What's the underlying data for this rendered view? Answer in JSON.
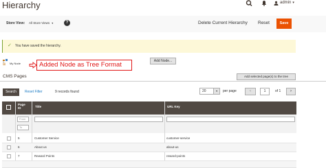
{
  "header": {
    "title": "Hierarchy",
    "user": "admin",
    "icons": [
      "search-icon",
      "bell-icon",
      "user-icon"
    ]
  },
  "toolbar": {
    "store_view_label": "Store View:",
    "store_view_value": "All Store Views",
    "delete_label": "Delete Current Hierarchy",
    "reset_label": "Reset",
    "save_label": "Save"
  },
  "message": {
    "text": "You have saved the hierarchy."
  },
  "tree": {
    "node_label": "My Node"
  },
  "annotation": {
    "text": "Added Node as Tree Format"
  },
  "buttons": {
    "add_node": "Add Node..."
  },
  "cms": {
    "title": "CMS Pages",
    "add_selected": "Add selected page(s) to the tree",
    "search": "Search",
    "reset_filter": "Reset Filter",
    "records_found": "9 records found",
    "per_page_value": "20",
    "per_page_label": "per page",
    "page_prev": "‹",
    "page_current": "1",
    "page_of": "of 1",
    "page_next": "›"
  },
  "grid": {
    "columns": {
      "id": "Page ID",
      "title": "Title",
      "url_key": "URL Key"
    },
    "filters": {
      "from": "From",
      "to": "To"
    },
    "rows": [
      {
        "id": "5",
        "title": "Customer Service",
        "url_key": "customer-service"
      },
      {
        "id": "6",
        "title": "About us",
        "url_key": "about-us"
      },
      {
        "id": "7",
        "title": "Reward Points",
        "url_key": "reward-points"
      }
    ]
  },
  "colors": {
    "accent": "#eb5202",
    "grid_header": "#514943",
    "annotation": "#e01515",
    "success": "#79a22e",
    "message_bg": "#fdf8d8"
  }
}
